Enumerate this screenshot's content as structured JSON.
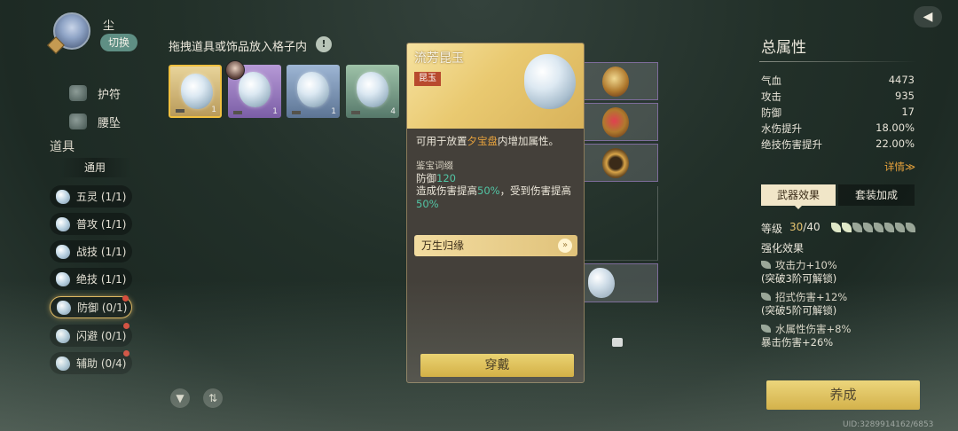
{
  "player": {
    "name": "尘",
    "switch_label": "切换"
  },
  "categories": [
    {
      "label": "护符",
      "icon": "amulet-icon"
    },
    {
      "label": "腰坠",
      "icon": "waist-pendant-icon"
    }
  ],
  "items_section": {
    "title": "道具",
    "general_label": "通用"
  },
  "slots": [
    {
      "label": "五灵 (1/1)",
      "alert": false
    },
    {
      "label": "普攻 (1/1)",
      "alert": false
    },
    {
      "label": "战技 (1/1)",
      "alert": false
    },
    {
      "label": "绝技 (1/1)",
      "alert": false
    },
    {
      "label": "防御 (0/1)",
      "alert": true,
      "selected": true
    },
    {
      "label": "闪避 (0/1)",
      "alert": true
    },
    {
      "label": "辅助 (0/4)",
      "alert": true
    }
  ],
  "inventory": {
    "hint": "拖拽道具或饰品放入格子内",
    "help": "!",
    "items": [
      {
        "count": "1",
        "rarity": "gold"
      },
      {
        "count": "1",
        "rarity": "purple"
      },
      {
        "count": "1",
        "rarity": "blue"
      },
      {
        "count": "4",
        "rarity": "green"
      }
    ]
  },
  "tooltip": {
    "title": "流芳昆玉",
    "tag": "昆玉",
    "desc_prefix": "可用于放置",
    "desc_highlight": "夕宝盘",
    "desc_suffix": "内增加属性。",
    "attr_title": "鉴宝词缀",
    "attr1_label": "防御",
    "attr1_value": "120",
    "attr2_a": "造成伤害提高",
    "attr2_b": "50%",
    "attr2_c": "，受到伤害提高",
    "attr2_d": "50%",
    "set_name": "万生归缘",
    "equip_label": "穿戴"
  },
  "summary": {
    "title": "总属性",
    "stats": [
      {
        "label": "气血",
        "value": "4473"
      },
      {
        "label": "攻击",
        "value": "935"
      },
      {
        "label": "防御",
        "value": "17"
      },
      {
        "label": "水伤提升",
        "value": "18.00%"
      },
      {
        "label": "绝技伤害提升",
        "value": "22.00%"
      }
    ],
    "detail_link": "详情≫",
    "tabs": {
      "weapon": "武器效果",
      "set": "套装加成"
    },
    "level_label": "等级",
    "level_current": "30",
    "level_max": "/40",
    "level_pips_filled": 2,
    "level_pips_total": 8,
    "enhance_title": "强化效果",
    "effects": [
      {
        "line1": "攻击力+10%",
        "line2": "(突破3阶可解锁)"
      },
      {
        "line1": "招式伤害+12%",
        "line2": "(突破5阶可解锁)"
      },
      {
        "line1": "水属性伤害+8%",
        "line2": "暴击伤害+26%"
      }
    ],
    "cultivate_label": "养成"
  },
  "uid": "UID:3289914162/6853",
  "colors": {
    "accent_gold": "#e7a23c",
    "value_green": "#52c4a4",
    "button_gold": "#e8c04a"
  }
}
